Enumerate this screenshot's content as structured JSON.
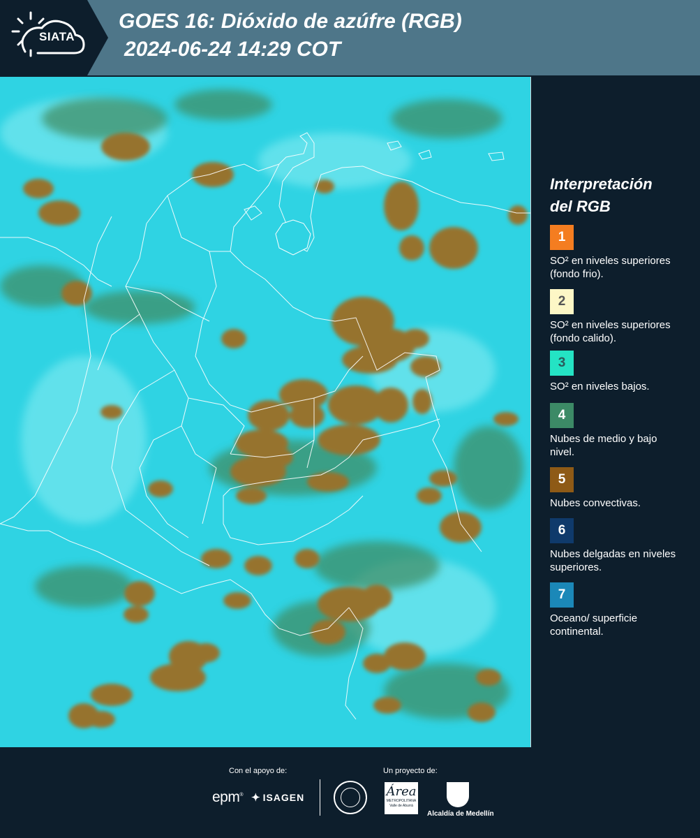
{
  "header": {
    "logo_text": "SIATA",
    "title_line1": "GOES 16: Dióxido de azúfre (RGB)",
    "title_line2": "2024-06-24 14:29 COT"
  },
  "legend": {
    "title": "Interpretación del RGB",
    "items": [
      {
        "number": "1",
        "color": "#f47d20",
        "number_color": "#ffffff",
        "description": "SO² en niveles superiores (fondo frio)."
      },
      {
        "number": "2",
        "color": "#fdf7c6",
        "number_color": "#555555",
        "description": "SO² en niveles superiores (fondo calido)."
      },
      {
        "number": "3",
        "color": "#24e3c4",
        "number_color": "#2b5a5a",
        "description": "SO² en niveles bajos."
      },
      {
        "number": "4",
        "color": "#3c8a66",
        "number_color": "#ffffff",
        "description": "Nubes de medio y bajo nivel."
      },
      {
        "number": "5",
        "color": "#8e5a16",
        "number_color": "#ffffff",
        "description": "Nubes convectivas."
      },
      {
        "number": "6",
        "color": "#0f3a6b",
        "number_color": "#ffffff",
        "description": "Nubes delgadas en niveles superiores."
      },
      {
        "number": "7",
        "color": "#1b88b8",
        "number_color": "#ffffff",
        "description": "Oceano/ superficie continental."
      }
    ]
  },
  "map": {
    "background_color": "#2fd3e3",
    "convective_cloud_color": "#96732e",
    "mid_cloud_color": "#3f8a5e",
    "border_color": "#ffffff"
  },
  "footer": {
    "support_caption": "Con el apoyo de:",
    "project_caption": "Un proyecto de:",
    "epm_logo": "epm",
    "isagen_logo": "ISAGEN",
    "area_logo_script": "Área",
    "area_logo_sub": "METROPOLITANA Valle de Aburrá",
    "medellin_label": "Alcaldía de Medellín"
  }
}
